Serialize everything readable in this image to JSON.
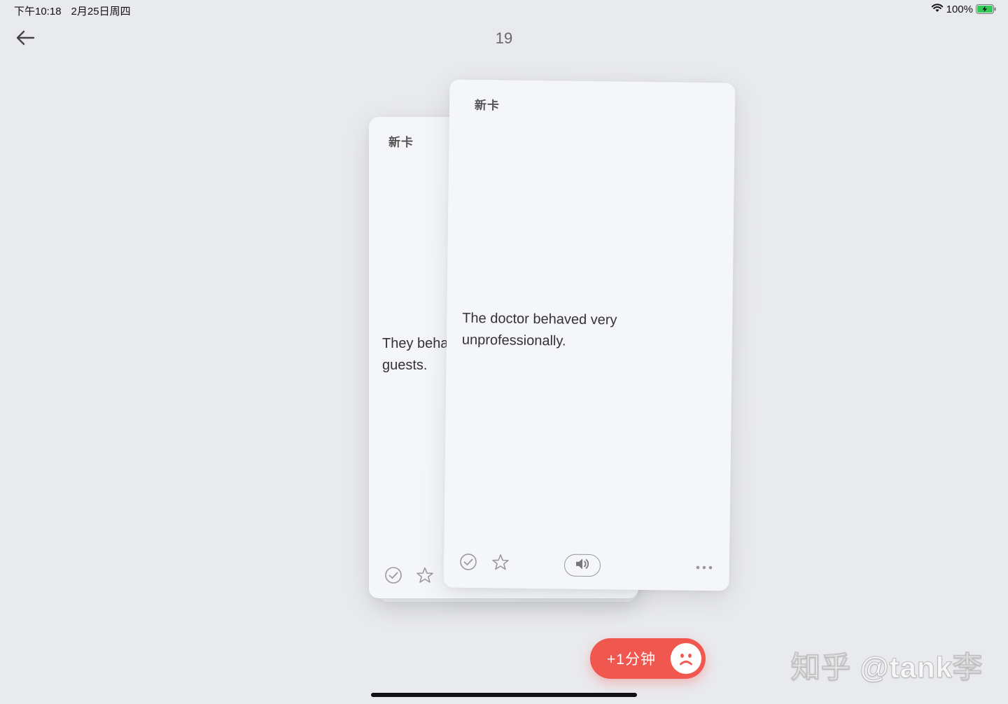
{
  "status_bar": {
    "time": "下午10:18",
    "date": "2月25日周四",
    "battery": "100%"
  },
  "nav": {
    "counter": "19"
  },
  "cards": {
    "back": {
      "tag": "新卡",
      "text": "They beha\nguests."
    },
    "front": {
      "tag": "新卡",
      "text": "The doctor behaved very unprofessionally."
    }
  },
  "add_time_button": {
    "label": "+1分钟"
  },
  "watermark": "知乎 @tank李",
  "colors": {
    "background": "#e9eaee",
    "card": "#f4f6f9",
    "accent_red": "#f0574f"
  },
  "icons": {
    "back": "arrow-left-icon",
    "check": "check-circle-icon",
    "star": "star-icon",
    "speaker": "speaker-icon",
    "more": "more-dots-icon",
    "sad": "sad-face-icon",
    "wifi": "wifi-icon",
    "battery": "battery-charging-icon"
  }
}
